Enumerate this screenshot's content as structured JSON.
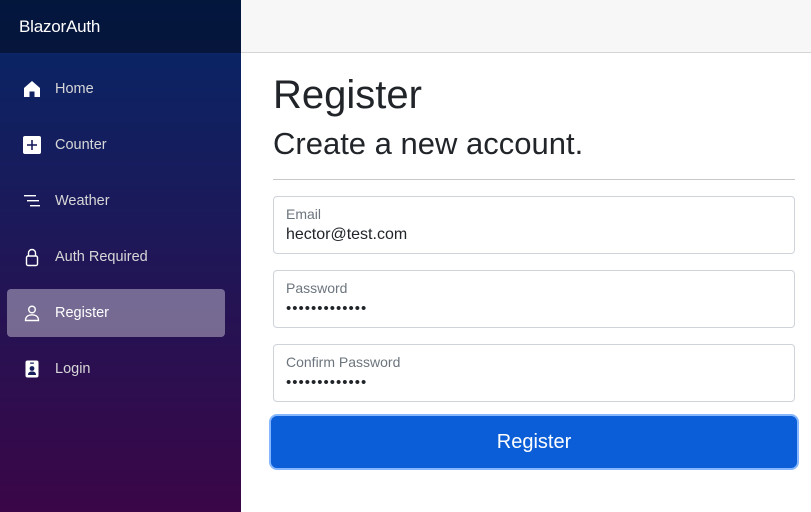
{
  "app": {
    "brand": "BlazorAuth"
  },
  "sidebar": {
    "items": [
      {
        "label": "Home",
        "icon": "house-icon"
      },
      {
        "label": "Counter",
        "icon": "plus-square-icon"
      },
      {
        "label": "Weather",
        "icon": "list-lines-icon"
      },
      {
        "label": "Auth Required",
        "icon": "lock-icon"
      },
      {
        "label": "Register",
        "icon": "person-icon",
        "active": true
      },
      {
        "label": "Login",
        "icon": "person-badge-icon"
      }
    ]
  },
  "page": {
    "title": "Register",
    "subtitle": "Create a new account."
  },
  "form": {
    "email": {
      "label": "Email",
      "value": "hector@test.com"
    },
    "password": {
      "label": "Password",
      "value": "•••••••••••••"
    },
    "confirm_password": {
      "label": "Confirm Password",
      "value": "•••••••••••••"
    },
    "submit_label": "Register"
  },
  "colors": {
    "sidebar_top": "#052767",
    "sidebar_bottom": "#3a0647",
    "primary": "#0b5ed7"
  }
}
